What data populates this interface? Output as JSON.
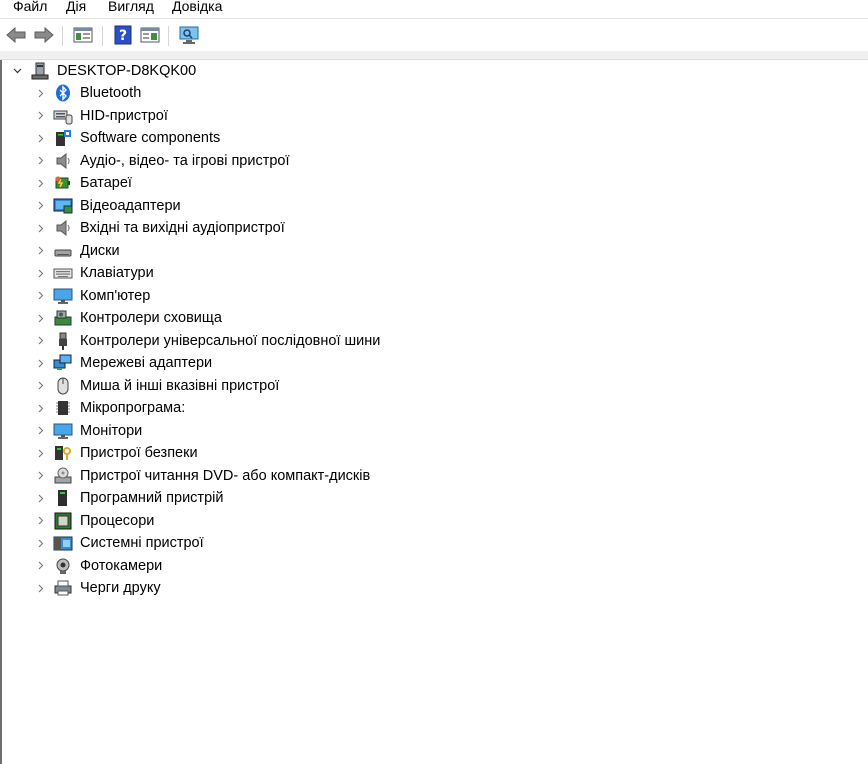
{
  "menu": [
    "Файл",
    "Дія",
    "Вигляд",
    "Довідка"
  ],
  "toolbar": {
    "buttons": [
      "back-icon",
      "forward-icon",
      "properties-icon",
      "help-icon",
      "action-pane-icon",
      "scan-hardware-icon"
    ]
  },
  "tree": {
    "root": {
      "label": "DESKTOP-D8KQK00",
      "icon": "computer-root-icon"
    },
    "items": [
      {
        "label": "Bluetooth",
        "icon": "bluetooth-icon"
      },
      {
        "label": "HID-пристрої",
        "icon": "hid-icon"
      },
      {
        "label": "Software components",
        "icon": "software-components-icon"
      },
      {
        "label": "Аудіо-, відео- та ігрові пристрої",
        "icon": "speaker-icon"
      },
      {
        "label": "Батареї",
        "icon": "battery-icon"
      },
      {
        "label": "Відеоадаптери",
        "icon": "display-adapter-icon"
      },
      {
        "label": "Вхідні та вихідні аудіопристрої",
        "icon": "speaker-icon"
      },
      {
        "label": "Диски",
        "icon": "disk-icon"
      },
      {
        "label": "Клавіатури",
        "icon": "keyboard-icon"
      },
      {
        "label": "Комп'ютер",
        "icon": "monitor-icon"
      },
      {
        "label": "Контролери сховища",
        "icon": "storage-controller-icon"
      },
      {
        "label": "Контролери універсальної послідовної шини",
        "icon": "usb-icon"
      },
      {
        "label": "Мережеві адаптери",
        "icon": "network-adapter-icon"
      },
      {
        "label": "Миша й інші вказівні пристрої",
        "icon": "mouse-icon"
      },
      {
        "label": "Мікропрограма:",
        "icon": "firmware-icon"
      },
      {
        "label": "Монітори",
        "icon": "monitor-icon"
      },
      {
        "label": "Пристрої безпеки",
        "icon": "security-device-icon"
      },
      {
        "label": "Пристрої читання DVD- або компакт-дисків",
        "icon": "dvd-icon"
      },
      {
        "label": "Програмний пристрій",
        "icon": "software-device-icon"
      },
      {
        "label": "Процесори",
        "icon": "processor-icon"
      },
      {
        "label": "Системні пристрої",
        "icon": "system-devices-icon"
      },
      {
        "label": "Фотокамери",
        "icon": "camera-icon"
      },
      {
        "label": "Черги друку",
        "icon": "printer-icon"
      }
    ]
  }
}
